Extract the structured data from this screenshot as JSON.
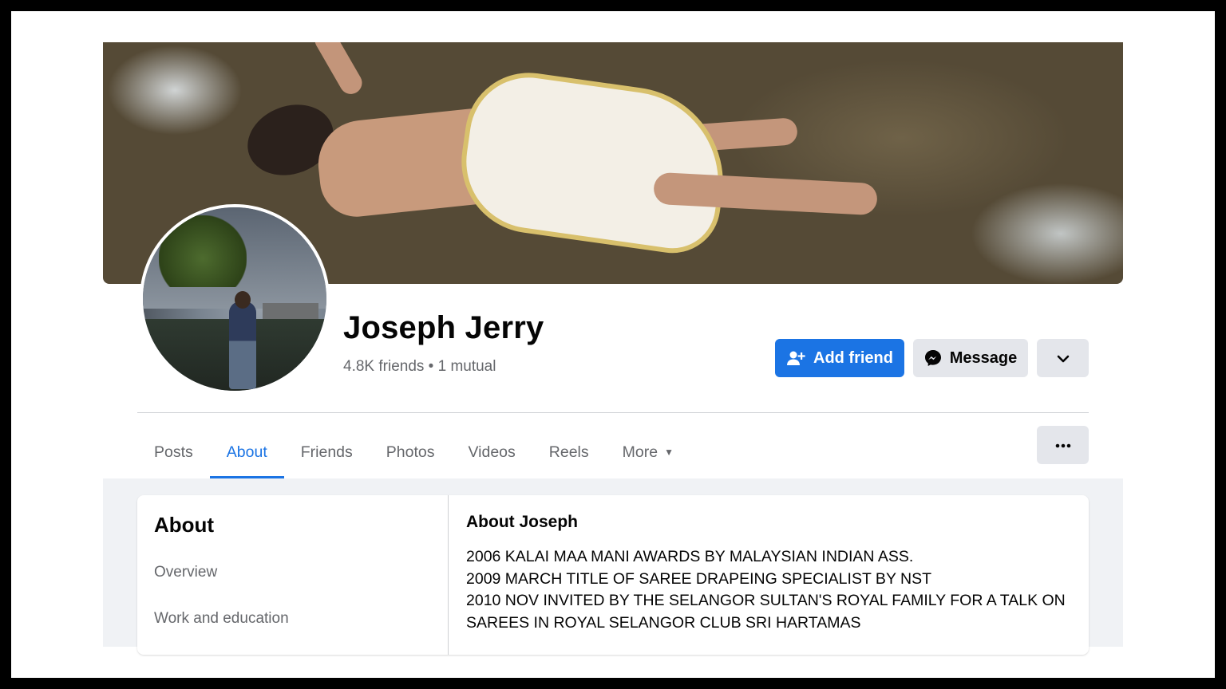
{
  "profile": {
    "name": "Joseph Jerry",
    "friends_line": "4.8K friends • 1 mutual"
  },
  "actions": {
    "add_friend": "Add friend",
    "message": "Message",
    "more_icon": "chevron-down-icon"
  },
  "tabs": [
    {
      "label": "Posts",
      "active": false
    },
    {
      "label": "About",
      "active": true
    },
    {
      "label": "Friends",
      "active": false
    },
    {
      "label": "Photos",
      "active": false
    },
    {
      "label": "Videos",
      "active": false
    },
    {
      "label": "Reels",
      "active": false
    },
    {
      "label": "More",
      "active": false
    }
  ],
  "about": {
    "title": "About",
    "nav": [
      "Overview",
      "Work and education"
    ],
    "section_title": "About Joseph",
    "bio_lines": [
      "2006 KALAI MAA MANI  AWARDS BY MALAYSIAN INDIAN ASS.",
      "2009 MARCH TITLE OF SAREE DRAPEING SPECIALIST BY NST",
      "2010 NOV INVITED BY THE SELANGOR SULTAN'S ROYAL FAMILY FOR A TALK ON",
      "SAREES IN ROYAL SELANGOR CLUB SRI HARTAMAS"
    ]
  },
  "colors": {
    "primary": "#1b74e4",
    "secondary_button": "#e4e6eb",
    "muted_text": "#65676b",
    "page_bg": "#f0f2f5"
  }
}
